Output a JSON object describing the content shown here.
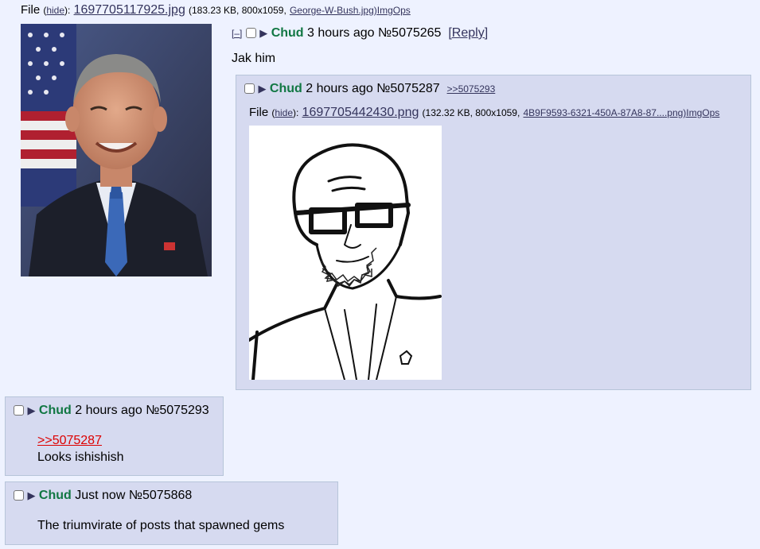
{
  "op": {
    "file_prefix": "File",
    "hide_label": "hide",
    "filename": "1697705117925.jpg",
    "file_meta_before": "(183.23 KB, 800x1059,",
    "original_name": "George-W-Bush.jpg)",
    "imgops": "ImgOps",
    "collapse": "[–]",
    "name": "Chud",
    "time": "3 hours ago",
    "post_no": "№5075265",
    "reply_link": "[Reply]",
    "message": "Jak him"
  },
  "reply1": {
    "name": "Chud",
    "time": "2 hours ago",
    "post_no": "№5075287",
    "backlink": ">>5075293",
    "file_prefix": "File",
    "hide_label": "hide",
    "filename": "1697705442430.png",
    "file_meta_before": "(132.32 KB, 800x1059,",
    "original_name": "4B9F9593-6321-450A-87A8-87....png)",
    "imgops": "ImgOps"
  },
  "reply2": {
    "name": "Chud",
    "time": "2 hours ago",
    "post_no": "№5075293",
    "quote": ">>5075287",
    "message": "Looks ishishish"
  },
  "reply3": {
    "name": "Chud",
    "time": "Just now",
    "post_no": "№5075868",
    "message": "The triumvirate of posts that spawned gems"
  },
  "colors": {
    "background": "#eef2ff",
    "reply_bg": "#d6daf0",
    "name": "#117743",
    "quote": "#dd0000"
  }
}
